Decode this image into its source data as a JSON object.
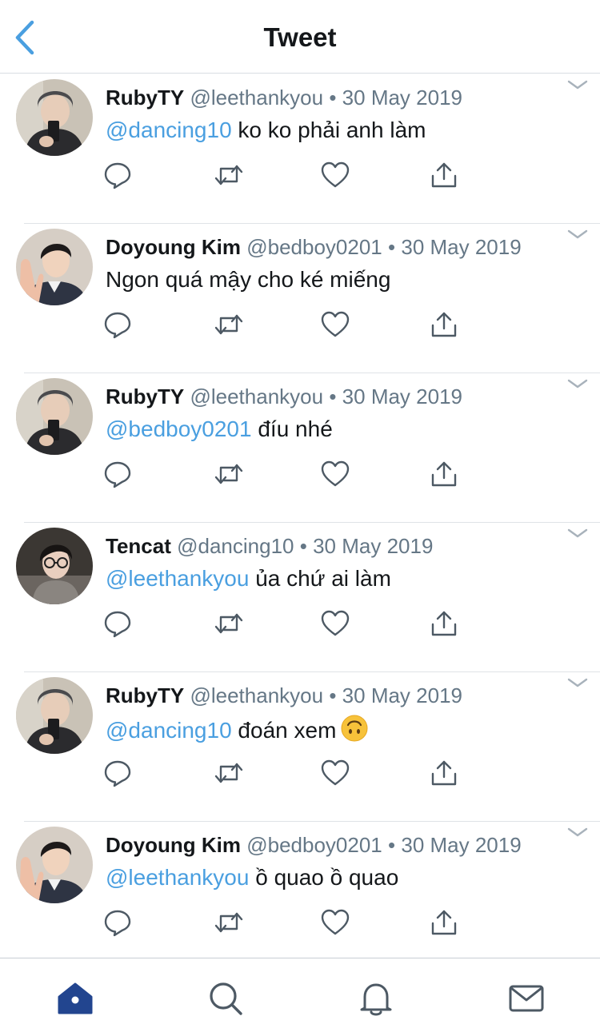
{
  "header": {
    "title": "Tweet"
  },
  "colors": {
    "accent": "#4a9fe0",
    "muted": "#657786",
    "icon": "#4d5964",
    "home_active": "#22458f"
  },
  "icons": {
    "back": "chevron-left-icon",
    "reply": "reply-icon",
    "retweet": "retweet-icon",
    "like": "heart-icon",
    "share": "share-icon",
    "caret": "chevron-down-icon"
  },
  "tweets": [
    {
      "avatar": "rubyty",
      "name": "RubyTY",
      "handle": "@leethankyou",
      "dot": "•",
      "date": "30 May 2019",
      "mention": "@dancing10",
      "text": " ko ko phải anh làm",
      "emoji": ""
    },
    {
      "avatar": "doyoung",
      "name": "Doyoung Kim",
      "handle": "@bedboy0201",
      "dot": "•",
      "date": "30 May 2019",
      "mention": "",
      "text": "Ngon quá mậy cho ké miếng",
      "emoji": ""
    },
    {
      "avatar": "rubyty",
      "name": "RubyTY",
      "handle": "@leethankyou",
      "dot": "•",
      "date": "30 May 2019",
      "mention": "@bedboy0201",
      "text": " đíu nhé",
      "emoji": ""
    },
    {
      "avatar": "tencat",
      "name": "Tencat",
      "handle": "@dancing10",
      "dot": "•",
      "date": "30 May 2019",
      "mention": "@leethankyou",
      "text": " ủa chứ ai làm",
      "emoji": ""
    },
    {
      "avatar": "rubyty",
      "name": "RubyTY",
      "handle": "@leethankyou",
      "dot": "•",
      "date": "30 May 2019",
      "mention": "@dancing10",
      "text": " đoán xem",
      "emoji": "upside-down-face"
    },
    {
      "avatar": "doyoung",
      "name": "Doyoung Kim",
      "handle": "@bedboy0201",
      "dot": "•",
      "date": "30 May 2019",
      "mention": "@leethankyou",
      "text": " ồ quao ồ quao",
      "emoji": ""
    }
  ],
  "tabbar": [
    {
      "icon": "home-icon",
      "active": true
    },
    {
      "icon": "search-icon",
      "active": false
    },
    {
      "icon": "bell-icon",
      "active": false
    },
    {
      "icon": "mail-icon",
      "active": false
    }
  ]
}
